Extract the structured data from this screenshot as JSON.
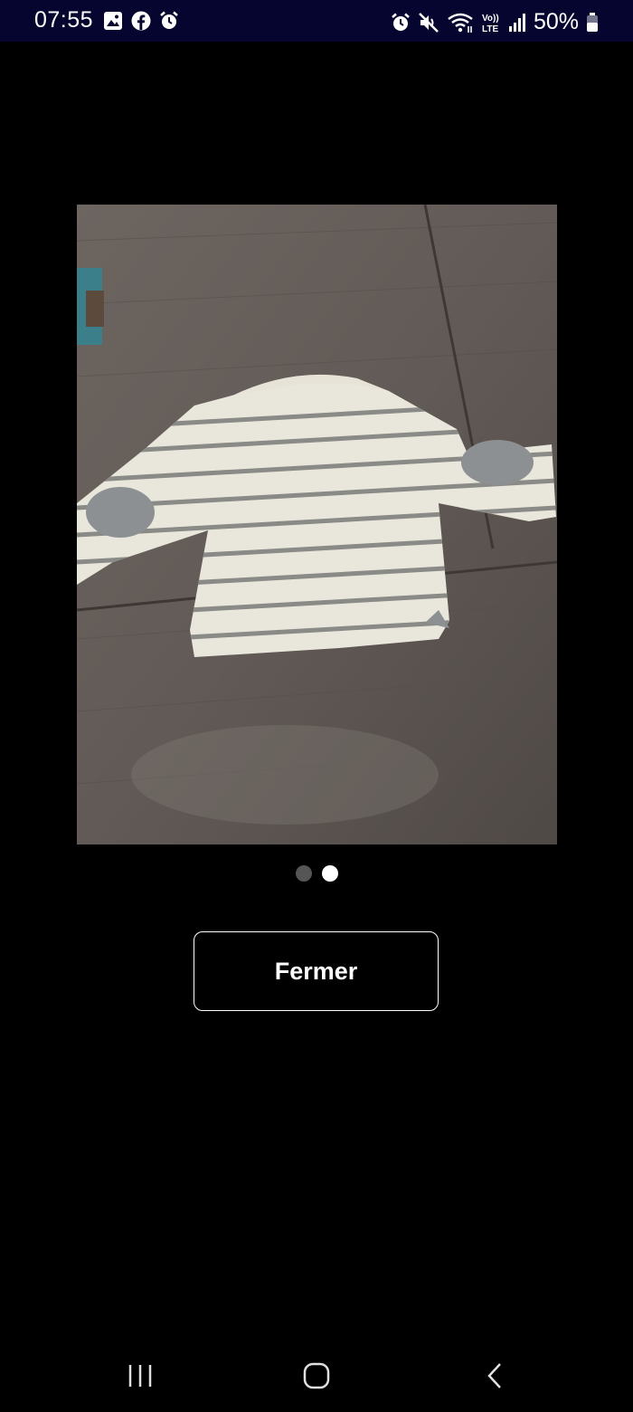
{
  "status_bar": {
    "time": "07:55",
    "battery": "50%",
    "left_icons": [
      "gallery-icon",
      "facebook-icon",
      "alarm-icon"
    ],
    "right_icons": [
      "alarm-icon",
      "mute-icon",
      "wifi-icon",
      "volte-lte-icon",
      "signal-icon",
      "battery-icon"
    ],
    "volte_label": "Vo)) LTE"
  },
  "viewer": {
    "image_alt": "Striped long-sleeve baby top on wooden table",
    "pages": 2,
    "current_page": 2
  },
  "actions": {
    "close_label": "Fermer"
  },
  "nav_bar": {
    "buttons": [
      "recent-apps-icon",
      "home-icon",
      "back-icon"
    ]
  },
  "colors": {
    "background": "#000000",
    "status_bar": "#050530",
    "button_border": "#ffffff",
    "dot_inactive": "#555555",
    "dot_active": "#ffffff"
  }
}
